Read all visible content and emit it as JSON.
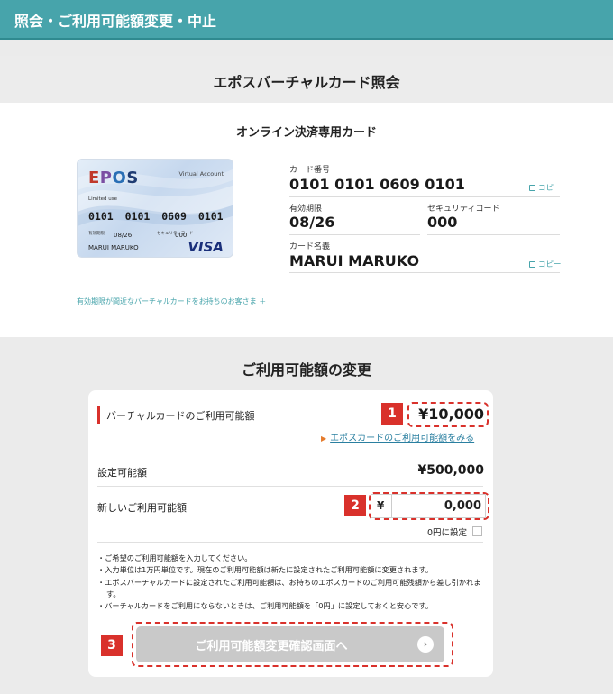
{
  "header": {
    "title": "照会・ご利用可能額変更・中止"
  },
  "section1": {
    "title": "エポスバーチャルカード照会",
    "subtitle": "オンライン決済専用カード",
    "card_image": {
      "brand": "EPOS",
      "type_text": "Virtual Account",
      "limited": "Limited use",
      "number": "0101  0101  0609  0101",
      "expiry_label": "有効期限",
      "expiry": "08/26",
      "security_label": "セキュリティコード",
      "security": "000",
      "name": "MARUI MARUKO",
      "network": "VISA"
    },
    "info": {
      "card_number_label": "カード番号",
      "card_number": "0101 0101 0609 0101",
      "expiry_label": "有効期限",
      "expiry": "08/26",
      "security_label": "セキュリティコード",
      "security": "000",
      "name_label": "カード名義",
      "name": "MARUI MARUKO",
      "copy_label": "コピー"
    },
    "notice_link": "有効期限が間近なバーチャルカードをお持ちのお客さま ＋"
  },
  "section2": {
    "title": "ご利用可能額の変更",
    "current_label": "バーチャルカードのご利用可能額",
    "current_value": "¥10,000",
    "link_more": "エポスカードのご利用可能額をみる",
    "settable_label": "設定可能額",
    "settable_value": "¥500,000",
    "new_label": "新しいご利用可能額",
    "input_currency": "¥",
    "input_value": "0,000",
    "zero_label": "0円に設定",
    "notes": [
      "・ご希望のご利用可能額を入力してください。",
      "・入力単位は1万円単位です。現在のご利用可能額は新たに設定されたご利用可能額に変更されます。",
      "・エポスバーチャルカードに設定されたご利用可能額は、お持ちのエポスカードのご利用可能残額から差し引かれます。",
      "・バーチャルカードをご利用にならないときは、ご利用可能額を「0円」に設定しておくと安心です。"
    ],
    "confirm_button": "ご利用可能額変更確認画面へ"
  },
  "badges": {
    "one": "1",
    "two": "2",
    "three": "3"
  },
  "colors": {
    "teal": "#47a4ab",
    "accent_red": "#d9312b",
    "button_disabled": "#c9c9c9"
  }
}
